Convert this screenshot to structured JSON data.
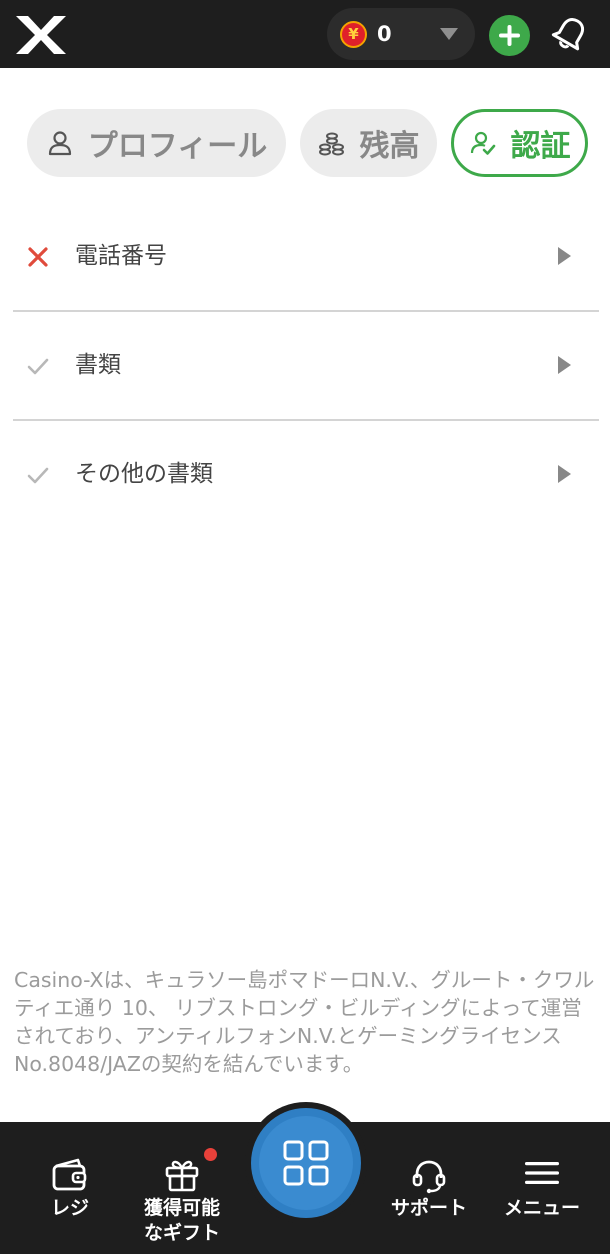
{
  "header": {
    "currency_symbol": "¥",
    "balance": "0"
  },
  "tabs": [
    {
      "label": "プロフィール",
      "icon": "user-icon",
      "active": false
    },
    {
      "label": "残高",
      "icon": "coins-icon",
      "active": false
    },
    {
      "label": "認証",
      "icon": "user-check-icon",
      "active": true
    }
  ],
  "verification_items": [
    {
      "label": "電話番号",
      "status": "failed",
      "status_icon": "cross-icon"
    },
    {
      "label": "書類",
      "status": "pending",
      "status_icon": "check-icon"
    },
    {
      "label": "その他の書類",
      "status": "pending",
      "status_icon": "check-icon"
    }
  ],
  "legal_text": "Casino-Xは、キュラソー島ポマドーロN.V.、グルート・クワルティエ通り 10、 リブストロング・ビルディングによって運営されており、アンティルフォンN.V.とゲーミングライセンスNo.8048/JAZの契約を結んでいます。",
  "bottom_nav": {
    "cashier": "レジ",
    "gifts_line1": "獲得可能",
    "gifts_line2": "なギフト",
    "support": "サポート",
    "menu": "メニュー"
  },
  "colors": {
    "accent_green": "#3ea94a",
    "error_red": "#e04b3c",
    "nav_blue": "#2f7fc4",
    "dark_bar": "#1e1e1e"
  }
}
